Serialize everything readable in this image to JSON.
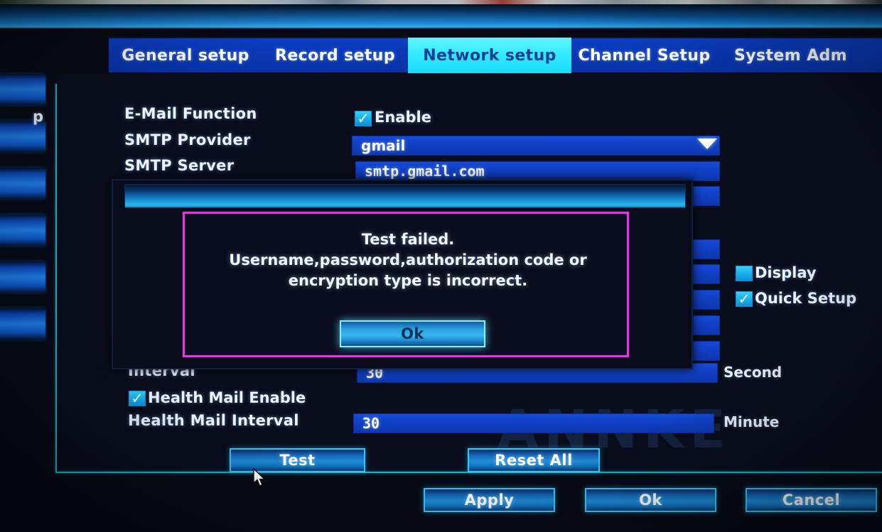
{
  "window": {
    "title": ""
  },
  "tabs": [
    {
      "label": "General setup",
      "active": false
    },
    {
      "label": "Record setup",
      "active": false
    },
    {
      "label": "Network setup",
      "active": true
    },
    {
      "label": "Channel Setup",
      "active": false
    },
    {
      "label": "System Adm",
      "active": false
    }
  ],
  "sidebar": {
    "visible_label": "p"
  },
  "watermark": "ANNKE",
  "form": {
    "rows": [
      {
        "label": "E-Mail Function"
      },
      {
        "label": "SMTP Provider"
      },
      {
        "label": "SMTP Server"
      },
      {
        "label": "Interval"
      },
      {
        "label": "Health Mail Interval"
      }
    ],
    "email_function": {
      "label": "E-Mail Function",
      "checkbox_label": "Enable",
      "checked": true
    },
    "smtp_provider": {
      "label": "SMTP Provider",
      "value": "gmail",
      "dropdown": true
    },
    "smtp_server": {
      "label": "SMTP Server",
      "value": "smtp.gmail.com"
    },
    "interval": {
      "label": "Interval",
      "value": "30",
      "unit": "Second"
    },
    "health_mail_enable": {
      "label": "Health Mail Enable",
      "checked": true
    },
    "health_mail_interval": {
      "label": "Health Mail Interval",
      "value": "30",
      "unit": "Minute"
    },
    "display": {
      "label": "Display",
      "checked": false
    },
    "quick_setup": {
      "label": "Quick Setup",
      "checked": true
    }
  },
  "actions": {
    "test": "Test",
    "reset_all": "Reset All",
    "apply": "Apply",
    "ok": "Ok",
    "cancel": "Cancel"
  },
  "dialog": {
    "title": "",
    "message_line1": "Test failed.",
    "message_line2": "Username,password,authorization code or",
    "message_line3": "encryption type is incorrect.",
    "ok_label": "Ok"
  },
  "colors": {
    "tab_bar": "#0a37b4",
    "tab_active_bg": "#2fe6fb",
    "tab_active_text": "#0f3f98",
    "field_bg": "#1140c4",
    "checkbox": "#16a9e8",
    "accent_border": "#1fb3c9",
    "dialog_border": "#f22bf2",
    "panel_bg": "#090d1c"
  }
}
